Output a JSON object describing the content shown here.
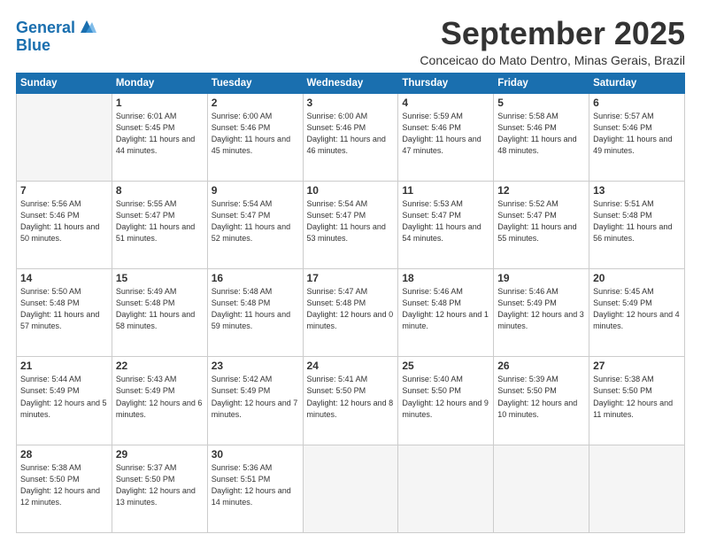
{
  "logo": {
    "line1": "General",
    "line2": "Blue"
  },
  "title": "September 2025",
  "subtitle": "Conceicao do Mato Dentro, Minas Gerais, Brazil",
  "weekdays": [
    "Sunday",
    "Monday",
    "Tuesday",
    "Wednesday",
    "Thursday",
    "Friday",
    "Saturday"
  ],
  "weeks": [
    [
      {
        "num": "",
        "sunrise": "",
        "sunset": "",
        "daylight": ""
      },
      {
        "num": "1",
        "sunrise": "Sunrise: 6:01 AM",
        "sunset": "Sunset: 5:45 PM",
        "daylight": "Daylight: 11 hours and 44 minutes."
      },
      {
        "num": "2",
        "sunrise": "Sunrise: 6:00 AM",
        "sunset": "Sunset: 5:46 PM",
        "daylight": "Daylight: 11 hours and 45 minutes."
      },
      {
        "num": "3",
        "sunrise": "Sunrise: 6:00 AM",
        "sunset": "Sunset: 5:46 PM",
        "daylight": "Daylight: 11 hours and 46 minutes."
      },
      {
        "num": "4",
        "sunrise": "Sunrise: 5:59 AM",
        "sunset": "Sunset: 5:46 PM",
        "daylight": "Daylight: 11 hours and 47 minutes."
      },
      {
        "num": "5",
        "sunrise": "Sunrise: 5:58 AM",
        "sunset": "Sunset: 5:46 PM",
        "daylight": "Daylight: 11 hours and 48 minutes."
      },
      {
        "num": "6",
        "sunrise": "Sunrise: 5:57 AM",
        "sunset": "Sunset: 5:46 PM",
        "daylight": "Daylight: 11 hours and 49 minutes."
      }
    ],
    [
      {
        "num": "7",
        "sunrise": "Sunrise: 5:56 AM",
        "sunset": "Sunset: 5:46 PM",
        "daylight": "Daylight: 11 hours and 50 minutes."
      },
      {
        "num": "8",
        "sunrise": "Sunrise: 5:55 AM",
        "sunset": "Sunset: 5:47 PM",
        "daylight": "Daylight: 11 hours and 51 minutes."
      },
      {
        "num": "9",
        "sunrise": "Sunrise: 5:54 AM",
        "sunset": "Sunset: 5:47 PM",
        "daylight": "Daylight: 11 hours and 52 minutes."
      },
      {
        "num": "10",
        "sunrise": "Sunrise: 5:54 AM",
        "sunset": "Sunset: 5:47 PM",
        "daylight": "Daylight: 11 hours and 53 minutes."
      },
      {
        "num": "11",
        "sunrise": "Sunrise: 5:53 AM",
        "sunset": "Sunset: 5:47 PM",
        "daylight": "Daylight: 11 hours and 54 minutes."
      },
      {
        "num": "12",
        "sunrise": "Sunrise: 5:52 AM",
        "sunset": "Sunset: 5:47 PM",
        "daylight": "Daylight: 11 hours and 55 minutes."
      },
      {
        "num": "13",
        "sunrise": "Sunrise: 5:51 AM",
        "sunset": "Sunset: 5:48 PM",
        "daylight": "Daylight: 11 hours and 56 minutes."
      }
    ],
    [
      {
        "num": "14",
        "sunrise": "Sunrise: 5:50 AM",
        "sunset": "Sunset: 5:48 PM",
        "daylight": "Daylight: 11 hours and 57 minutes."
      },
      {
        "num": "15",
        "sunrise": "Sunrise: 5:49 AM",
        "sunset": "Sunset: 5:48 PM",
        "daylight": "Daylight: 11 hours and 58 minutes."
      },
      {
        "num": "16",
        "sunrise": "Sunrise: 5:48 AM",
        "sunset": "Sunset: 5:48 PM",
        "daylight": "Daylight: 11 hours and 59 minutes."
      },
      {
        "num": "17",
        "sunrise": "Sunrise: 5:47 AM",
        "sunset": "Sunset: 5:48 PM",
        "daylight": "Daylight: 12 hours and 0 minutes."
      },
      {
        "num": "18",
        "sunrise": "Sunrise: 5:46 AM",
        "sunset": "Sunset: 5:48 PM",
        "daylight": "Daylight: 12 hours and 1 minute."
      },
      {
        "num": "19",
        "sunrise": "Sunrise: 5:46 AM",
        "sunset": "Sunset: 5:49 PM",
        "daylight": "Daylight: 12 hours and 3 minutes."
      },
      {
        "num": "20",
        "sunrise": "Sunrise: 5:45 AM",
        "sunset": "Sunset: 5:49 PM",
        "daylight": "Daylight: 12 hours and 4 minutes."
      }
    ],
    [
      {
        "num": "21",
        "sunrise": "Sunrise: 5:44 AM",
        "sunset": "Sunset: 5:49 PM",
        "daylight": "Daylight: 12 hours and 5 minutes."
      },
      {
        "num": "22",
        "sunrise": "Sunrise: 5:43 AM",
        "sunset": "Sunset: 5:49 PM",
        "daylight": "Daylight: 12 hours and 6 minutes."
      },
      {
        "num": "23",
        "sunrise": "Sunrise: 5:42 AM",
        "sunset": "Sunset: 5:49 PM",
        "daylight": "Daylight: 12 hours and 7 minutes."
      },
      {
        "num": "24",
        "sunrise": "Sunrise: 5:41 AM",
        "sunset": "Sunset: 5:50 PM",
        "daylight": "Daylight: 12 hours and 8 minutes."
      },
      {
        "num": "25",
        "sunrise": "Sunrise: 5:40 AM",
        "sunset": "Sunset: 5:50 PM",
        "daylight": "Daylight: 12 hours and 9 minutes."
      },
      {
        "num": "26",
        "sunrise": "Sunrise: 5:39 AM",
        "sunset": "Sunset: 5:50 PM",
        "daylight": "Daylight: 12 hours and 10 minutes."
      },
      {
        "num": "27",
        "sunrise": "Sunrise: 5:38 AM",
        "sunset": "Sunset: 5:50 PM",
        "daylight": "Daylight: 12 hours and 11 minutes."
      }
    ],
    [
      {
        "num": "28",
        "sunrise": "Sunrise: 5:38 AM",
        "sunset": "Sunset: 5:50 PM",
        "daylight": "Daylight: 12 hours and 12 minutes."
      },
      {
        "num": "29",
        "sunrise": "Sunrise: 5:37 AM",
        "sunset": "Sunset: 5:50 PM",
        "daylight": "Daylight: 12 hours and 13 minutes."
      },
      {
        "num": "30",
        "sunrise": "Sunrise: 5:36 AM",
        "sunset": "Sunset: 5:51 PM",
        "daylight": "Daylight: 12 hours and 14 minutes."
      },
      {
        "num": "",
        "sunrise": "",
        "sunset": "",
        "daylight": ""
      },
      {
        "num": "",
        "sunrise": "",
        "sunset": "",
        "daylight": ""
      },
      {
        "num": "",
        "sunrise": "",
        "sunset": "",
        "daylight": ""
      },
      {
        "num": "",
        "sunrise": "",
        "sunset": "",
        "daylight": ""
      }
    ]
  ]
}
